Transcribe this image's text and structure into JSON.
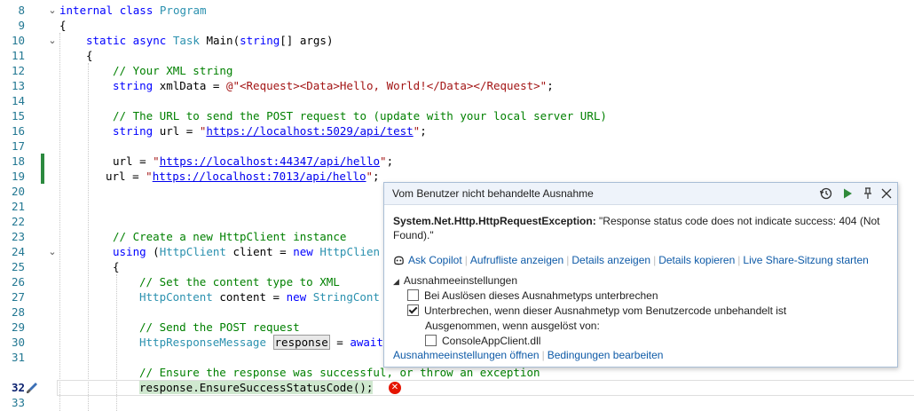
{
  "editor": {
    "line_numbers": [
      "8",
      "9",
      "10",
      "11",
      "12",
      "13",
      "14",
      "15",
      "16",
      "17",
      "18",
      "19",
      "20",
      "21",
      "22",
      "23",
      "24",
      "25",
      "26",
      "27",
      "28",
      "29",
      "30",
      "31",
      "32",
      "33"
    ],
    "current_line": "32",
    "code": {
      "l8_kw": "internal class",
      "l8_type": "Program",
      "l9": "{",
      "l10_kw": "static async",
      "l10_type": "Task",
      "l10_rest": "Main(",
      "l10_kw2": "string",
      "l10_rest2": "[] args)",
      "l11": "{",
      "l12_comment": "// Your XML string",
      "l13_kw": "string",
      "l13_rest": "xmlData = ",
      "l13_str": "@\"<Request><Data>Hello, World!</Data></Request>\"",
      "l13_end": ";",
      "l15_comment": "// The URL to send the POST request to (update with your local server URL)",
      "l16_kw": "string",
      "l16_rest": "url = ",
      "l16_q1": "\"",
      "l16_url": "https://localhost:5029/api/test",
      "l16_q2": "\"",
      "l16_end": ";",
      "l18_rest": "url = ",
      "l18_q1": "\"",
      "l18_url": "https://localhost:44347/api/hello",
      "l18_q2": "\"",
      "l18_end": ";",
      "l19_rest": "url = ",
      "l19_q1": "\"",
      "l19_url": "https://localhost:7013/api/hello",
      "l19_q2": "\"",
      "l19_end": ";",
      "l22_comment": "// Create a new HttpClient instance",
      "l23_kw": "using",
      "l23_rest": " (",
      "l23_type": "HttpClient",
      "l23_rest2": " client = ",
      "l23_kw2": "new",
      "l23_type2": "HttpClien",
      "l24": "{",
      "l25_comment": "// Set the content type to XML",
      "l26_type": "HttpContent",
      "l26_rest": " content = ",
      "l26_kw": "new",
      "l26_type2": "StringCont",
      "l28_comment": "// Send the POST request",
      "l29_type": "HttpResponseMessage",
      "l29_ref": "response",
      "l29_rest": " = ",
      "l29_kw": "await",
      "l31_comment": "// Ensure the response was successful, or throw an exception",
      "l32_exec": "response.EnsureSuccessStatusCode();"
    }
  },
  "popup": {
    "title": "Vom Benutzer nicht behandelte Ausnahme",
    "header_icons": [
      "history-icon",
      "continue-play-icon",
      "pin-icon",
      "close-icon"
    ],
    "exception_type": "System.Net.Http.HttpRequestException:",
    "exception_message": "\"Response status code does not indicate success: 404 (Not Found).\"",
    "actions": [
      {
        "label": "Ask Copilot"
      },
      {
        "label": "Aufrufliste anzeigen"
      },
      {
        "label": "Details anzeigen"
      },
      {
        "label": "Details kopieren"
      },
      {
        "label": "Live Share-Sitzung starten"
      }
    ],
    "settings": {
      "header": "Ausnahmeeinstellungen",
      "options": [
        {
          "label": "Bei Auslösen dieses Ausnahmetyps unterbrechen",
          "checked": false
        },
        {
          "label": "Unterbrechen, wenn dieser Ausnahmetyp vom Benutzercode unbehandelt ist",
          "checked": true
        }
      ],
      "except_label": "Ausgenommen, wenn ausgelöst von:",
      "except_items": [
        {
          "label": "ConsoleAppClient.dll",
          "checked": false
        }
      ]
    },
    "bottom_links": [
      {
        "label": "Ausnahmeeinstellungen öffnen"
      },
      {
        "label": "Bedingungen bearbeiten"
      }
    ]
  },
  "colors": {
    "change_bar": "#2c8a3f",
    "keyword": "#0000ff",
    "type": "#2b91af",
    "comment": "#008000",
    "string": "#a31515",
    "link": "#0e5aa7",
    "error": "#e51400"
  }
}
